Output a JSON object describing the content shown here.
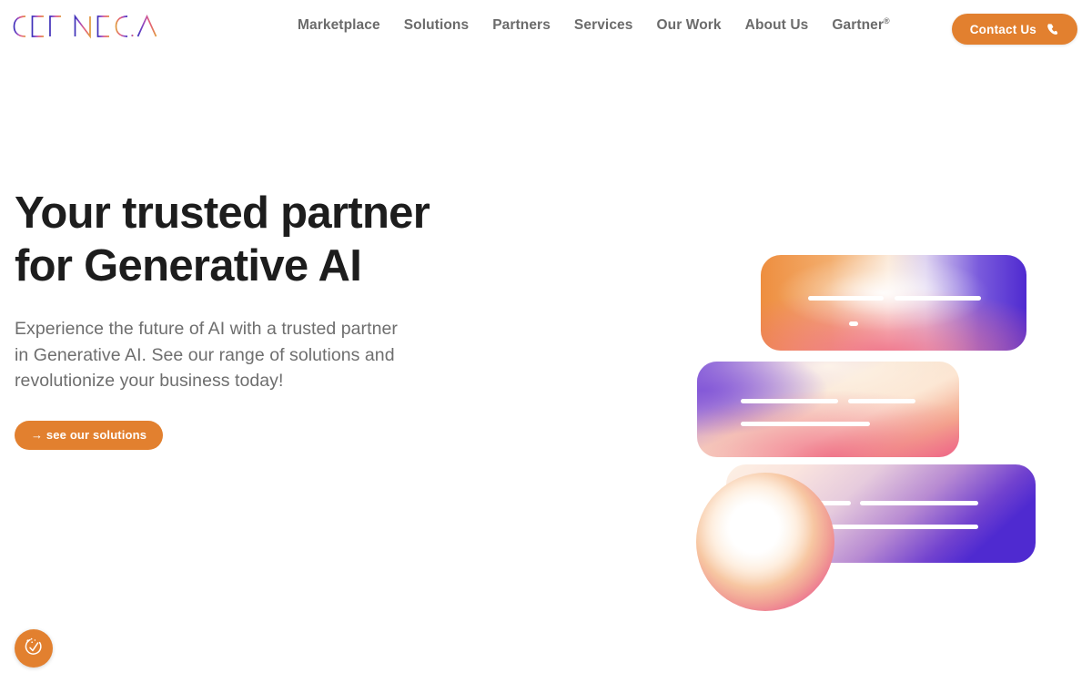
{
  "brand": {
    "name": "DEFINED.AI",
    "logo_text": "DEFINED.AI",
    "gradient_start": "#4b35c8",
    "gradient_mid": "#e0607f",
    "gradient_end": "#e2802f"
  },
  "theme": {
    "accent_orange": "#e2802f",
    "accent_orange_hover": "#d0731f",
    "nav_text": "#6b6b6b",
    "heading_text": "#1d1d1d",
    "body_text": "#6e6e6e",
    "page_background": "#ffffff",
    "card_purple": "#5a2fd0",
    "card_orange": "#ee8e3f",
    "card_pink": "#ef6f88",
    "card_cream": "#fdf3e8"
  },
  "header": {
    "nav_items": [
      {
        "label": "Marketplace",
        "name": "nav-marketplace"
      },
      {
        "label": "Solutions",
        "name": "nav-solutions"
      },
      {
        "label": "Partners",
        "name": "nav-partners"
      },
      {
        "label": "Services",
        "name": "nav-services"
      },
      {
        "label": "Our Work",
        "name": "nav-our-work"
      },
      {
        "label": "About Us",
        "name": "nav-about-us"
      },
      {
        "label": "Gartner",
        "superscript": "®",
        "name": "nav-gartner"
      }
    ],
    "contact_button": {
      "label": "Contact Us",
      "icon": "phone-icon"
    }
  },
  "hero": {
    "title_line_1": "Your trusted partner",
    "title_line_2": "for Generative AI",
    "subtitle": "Experience the future of AI with a trusted partner in Generative AI. See our range of solutions and revolutionize your business today!",
    "cta": {
      "label": "→ see our solutions",
      "arrow": "→",
      "text": "see our solutions"
    },
    "illustration": {
      "alt": "Three overlapping gradient cards with placeholder text lines and a glowing sphere",
      "cards": [
        {
          "name": "gradient-card-top",
          "lines": 3
        },
        {
          "name": "gradient-card-middle",
          "lines": 3
        },
        {
          "name": "gradient-card-bottom",
          "lines": 3
        }
      ],
      "sphere": {
        "name": "glowing-sphere"
      }
    }
  },
  "cookie_widget": {
    "icon": "cookie-consent-icon",
    "label": "Cookie preferences"
  }
}
